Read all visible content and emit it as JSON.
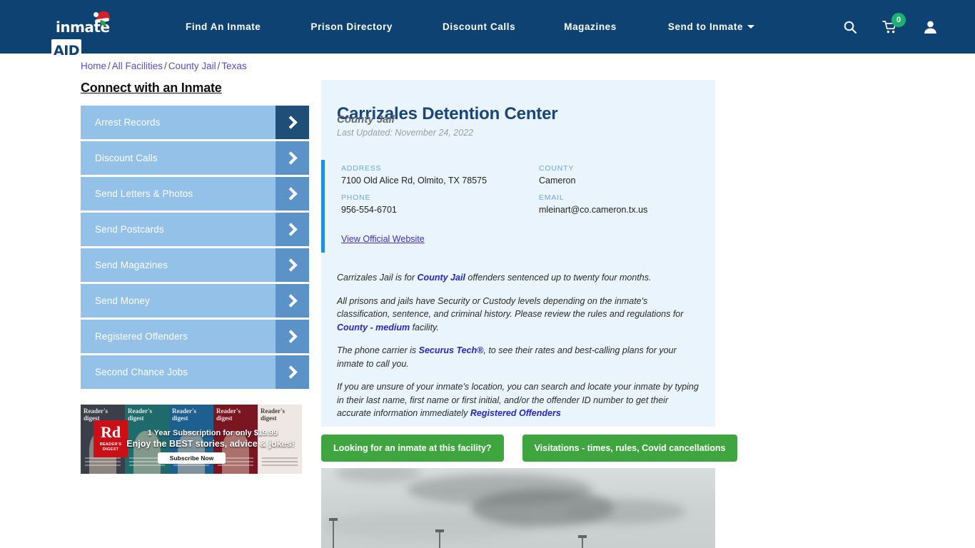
{
  "header": {
    "logo": {
      "name_part1": "inmate",
      "name_part2": "AID",
      "icon": "santa-hat-icon"
    },
    "nav": [
      {
        "label": "Find An Inmate",
        "has_dropdown": false
      },
      {
        "label": "Prison Directory",
        "has_dropdown": false
      },
      {
        "label": "Discount Calls",
        "has_dropdown": false
      },
      {
        "label": "Magazines",
        "has_dropdown": false
      },
      {
        "label": "Send to Inmate",
        "has_dropdown": true
      }
    ],
    "icons": {
      "search": "search-icon",
      "cart": "shopping-cart-icon",
      "cart_count": "0",
      "account": "user-account-icon"
    },
    "colors": {
      "background": "#0d4272",
      "badge": "#1ab172"
    }
  },
  "breadcrumb": {
    "items": [
      "Home",
      "All Facilities",
      "County Jail",
      "Texas"
    ],
    "separator": "/"
  },
  "sidebar": {
    "title": "Connect with an Inmate",
    "items": [
      {
        "label": "Arrest Records"
      },
      {
        "label": "Discount Calls"
      },
      {
        "label": "Send Letters & Photos"
      },
      {
        "label": "Send Postcards"
      },
      {
        "label": "Send Magazines"
      },
      {
        "label": "Send Money"
      },
      {
        "label": "Registered Offenders"
      },
      {
        "label": "Second Chance Jobs"
      }
    ],
    "ad": {
      "brand_initials": "Rd",
      "brand_name": "READER'S DIGEST",
      "headline": "1 Year Subscription for only $19.99",
      "subhead": "Enjoy the BEST stories, advice & jokes!",
      "cta": "Subscribe Now",
      "cover_title": "Reader's digest"
    }
  },
  "facility": {
    "name": "Carrizales Detention Center",
    "type": "County Jail",
    "last_updated": "Last Updated: November 24, 2022",
    "contact": {
      "address_label": "ADDRESS",
      "address_value": "7100 Old Alice Rd, Olmito, TX 78575",
      "county_label": "COUNTY",
      "county_value": "Cameron",
      "phone_label": "PHONE",
      "phone_value": "956-554-6701",
      "email_label": "EMAIL",
      "email_value": "mleinart@co.cameron.tx.us",
      "website_link": "View Official Website"
    },
    "paragraphs": {
      "p1_a": "Carrizales Jail is for ",
      "p1_link": "County Jail",
      "p1_b": " offenders sentenced up to twenty four months.",
      "p2_a": "All prisons and jails have Security or Custody levels depending on the inmate's classification, sentence, and criminal history. Please review the rules and regulations for ",
      "p2_link": "County - medium",
      "p2_b": " facility.",
      "p3_a": "The phone carrier is ",
      "p3_link": "Securus Tech®",
      "p3_b": ", to see their rates and best-calling plans for your inmate to call you.",
      "p4_a": "If you are unsure of your inmate's location, you can search and locate your inmate by typing in their last name, first name or first initial, and/or the offender ID number to get their accurate information immediately ",
      "p4_link": "Registered Offenders"
    },
    "cta_buttons": [
      {
        "label": "Looking for an inmate at this facility?"
      },
      {
        "label": "Visitations - times, rules, Covid cancellations"
      }
    ],
    "photo_alt": "Facility exterior under overcast sky"
  },
  "colors": {
    "brand_navy": "#0d4272",
    "panel_bg": "#e9f4fc",
    "accent_blue": "#1f8fe0",
    "sidebar_btn": "#94c1e8",
    "sidebar_arrow": "#5b93c9",
    "sidebar_arrow_active": "#1f4e79",
    "cta_green": "#3fa63f",
    "link_blue": "#2626c6",
    "breadcrumb_link": "#5b4bd0"
  }
}
